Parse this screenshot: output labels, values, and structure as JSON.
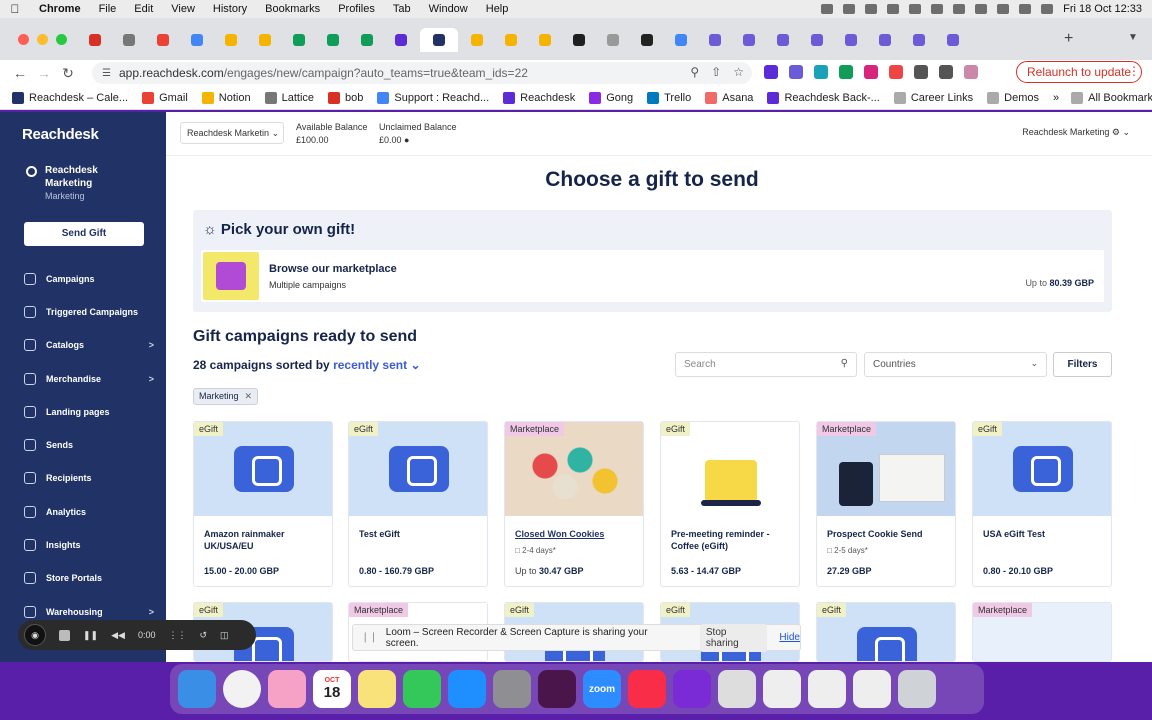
{
  "menubar": {
    "app": "Chrome",
    "items": [
      "File",
      "Edit",
      "View",
      "History",
      "Bookmarks",
      "Profiles",
      "Tab",
      "Window",
      "Help"
    ],
    "datetime": "Fri 18 Oct  12:33"
  },
  "browser": {
    "url_host": "app.reachdesk.com",
    "url_path": "/engages/new/campaign?auto_teams=true&team_ids=22",
    "relaunch_label": "Relaunch to update",
    "new_tab_symbol": "+"
  },
  "bookmarks": [
    "Reachdesk – Cale...",
    "Gmail",
    "Notion",
    "Lattice",
    "bob",
    "Support : Reachd...",
    "Reachdesk",
    "Gong",
    "Trello",
    "Asana",
    "Reachdesk Back-...",
    "Career Links",
    "Demos"
  ],
  "bookmarks_all": "All Bookmarks",
  "sidebar": {
    "logo": "Reachdesk",
    "user_name": "Reachdesk Marketing",
    "user_team": "Marketing",
    "send_gift": "Send Gift",
    "nav": [
      {
        "label": "Campaigns",
        "arrow": ""
      },
      {
        "label": "Triggered Campaigns",
        "arrow": ""
      },
      {
        "label": "Catalogs",
        "arrow": ">"
      },
      {
        "label": "Merchandise",
        "arrow": ">"
      },
      {
        "label": "Landing pages",
        "arrow": ""
      },
      {
        "label": "Sends",
        "arrow": ""
      },
      {
        "label": "Recipients",
        "arrow": ""
      },
      {
        "label": "Analytics",
        "arrow": ""
      },
      {
        "label": "Insights",
        "arrow": ""
      },
      {
        "label": "Store Portals",
        "arrow": ""
      },
      {
        "label": "Warehousing",
        "arrow": ">"
      }
    ]
  },
  "topbar": {
    "team_select": "Reachdesk Marketin",
    "available_label": "Available Balance",
    "available_value": "£100.00",
    "unclaimed_label": "Unclaimed Balance",
    "unclaimed_value": "£0.00",
    "account": "Reachdesk Marketing"
  },
  "main": {
    "title": "Choose a gift to send",
    "pick_title": "Pick your own gift!",
    "browse_title": "Browse our marketplace",
    "browse_sub": "Multiple campaigns",
    "browse_upto": "Up to",
    "browse_price": "80.39 GBP",
    "section_title": "Gift campaigns ready to send",
    "sorted_prefix": "28 campaigns sorted by",
    "sorted_link": "recently sent",
    "search_placeholder": "Search",
    "countries": "Countries",
    "filters": "Filters",
    "chip": "Marketing"
  },
  "cards": [
    {
      "badge": "eGift",
      "title": "Amazon rainmaker UK/USA/EU",
      "days": "",
      "price": "15.00 - 20.00 GBP",
      "up": ""
    },
    {
      "badge": "eGift",
      "title": "Test eGift",
      "days": "",
      "price": "0.80 - 160.79 GBP",
      "up": ""
    },
    {
      "badge": "Marketplace",
      "title": "Closed Won Cookies",
      "days": "2-4 days*",
      "price": "30.47 GBP",
      "up": "Up to"
    },
    {
      "badge": "eGift",
      "title": "Pre-meeting reminder - Coffee (eGift)",
      "days": "",
      "price": "5.63 - 14.47 GBP",
      "up": ""
    },
    {
      "badge": "Marketplace",
      "title": "Prospect Cookie Send",
      "days": "2-5 days*",
      "price": "27.29 GBP",
      "up": ""
    },
    {
      "badge": "eGift",
      "title": "USA eGift Test",
      "days": "",
      "price": "0.80 - 20.10 GBP",
      "up": ""
    }
  ],
  "cards_row2": [
    "eGift",
    "Marketplace",
    "eGift",
    "eGift",
    "eGift",
    "Marketplace"
  ],
  "loom": {
    "timer": "0:00",
    "message": "Loom – Screen Recorder & Screen Capture is sharing your screen.",
    "stop": "Stop sharing",
    "hide": "Hide"
  },
  "dock": {
    "calendar_month": "OCT",
    "calendar_day": "18",
    "zoom_label": "zoom"
  },
  "colors": {
    "sidebar": "#213366",
    "accent": "#3b5bdb",
    "wallpaper": "#5a1fa8"
  }
}
